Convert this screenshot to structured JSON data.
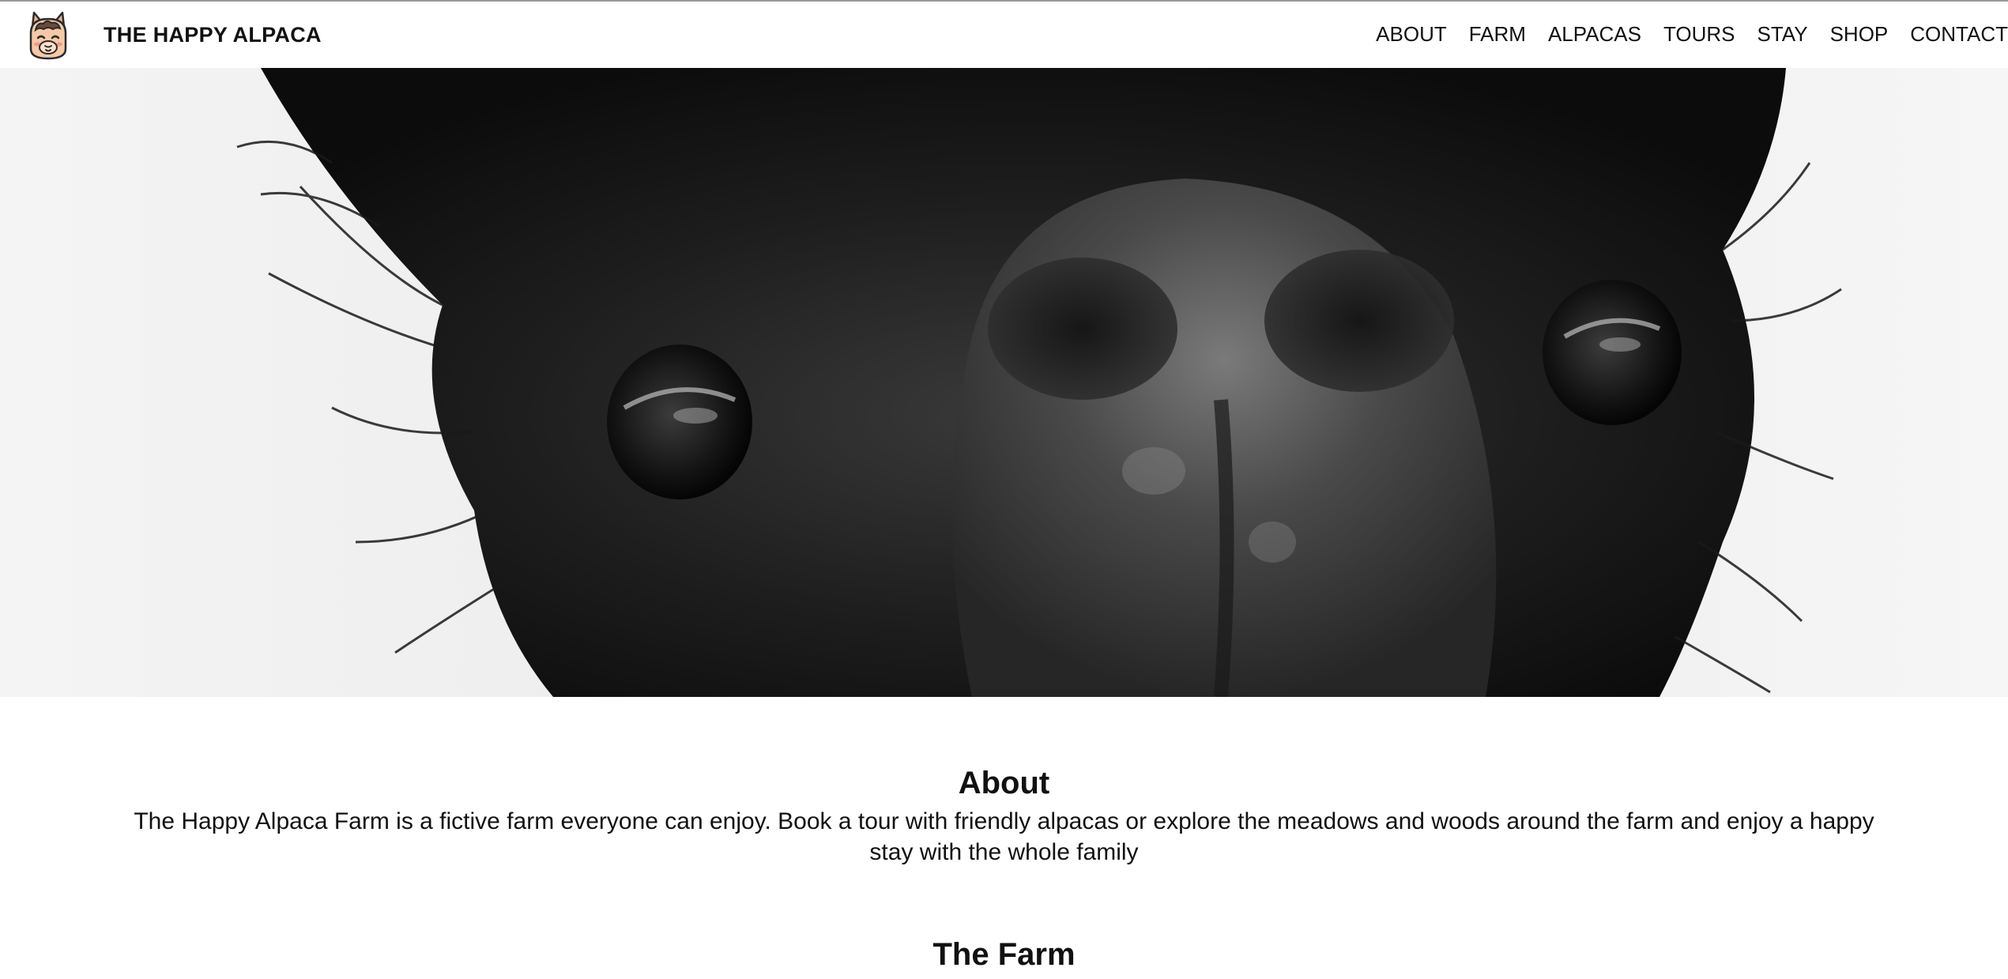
{
  "header": {
    "brand": "THE HAPPY ALPACA",
    "logo_icon": "alpaca-face-logo",
    "nav": [
      {
        "label": "ABOUT"
      },
      {
        "label": "FARM"
      },
      {
        "label": "ALPACAS"
      },
      {
        "label": "TOURS"
      },
      {
        "label": "STAY"
      },
      {
        "label": "SHOP"
      },
      {
        "label": "CONTACT"
      }
    ]
  },
  "hero": {
    "image": "black-and-white close-up alpaca face"
  },
  "about": {
    "title": "About",
    "text": "The Happy Alpaca Farm is a fictive farm everyone can enjoy. Book a tour with friendly alpacas or explore the meadows and woods around the farm and enjoy a happy stay with the whole family"
  },
  "farm": {
    "title": "The Farm"
  },
  "colors": {
    "text": "#111111",
    "background": "#ffffff",
    "logo_skin": "#f6c9a6",
    "logo_outline": "#2b2b2b"
  }
}
